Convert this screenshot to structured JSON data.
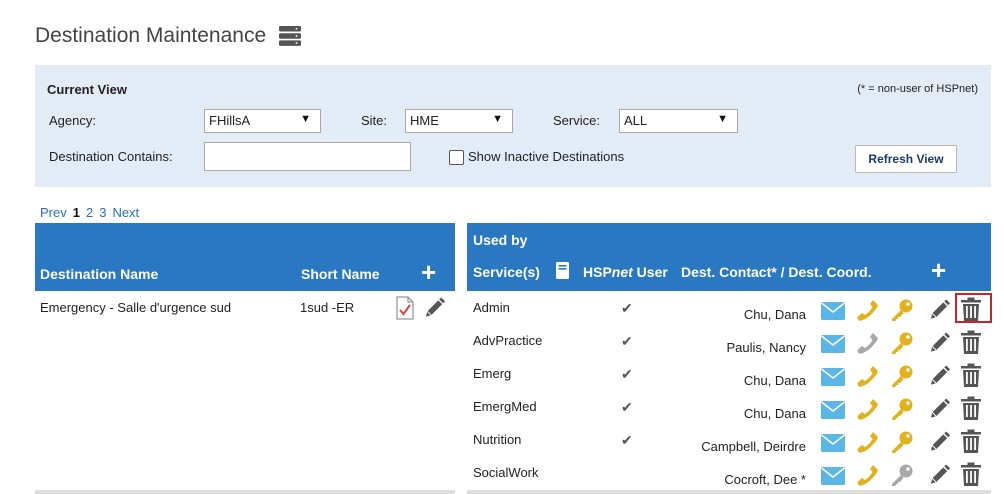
{
  "page": {
    "title": "Destination Maintenance"
  },
  "current_view": {
    "label": "Current View",
    "note": "(* = non-user of HSPnet)",
    "agency_label": "Agency:",
    "agency_value": "FHillsA",
    "site_label": "Site:",
    "site_value": "HME",
    "service_label": "Service:",
    "service_value": "ALL",
    "dest_contains_label": "Destination Contains:",
    "dest_contains_value": "",
    "show_inactive_label": "Show Inactive Destinations",
    "refresh_label": "Refresh View",
    "dropdown_arrow": "▼"
  },
  "pager": {
    "prev": "Prev",
    "pages": [
      "1",
      "2",
      "3"
    ],
    "current": "1",
    "next": "Next"
  },
  "dest_table": {
    "col_name": "Destination Name",
    "col_short": "Short Name",
    "add_icon": "+",
    "rows": [
      {
        "name": "Emergency - Salle d'urgence sud",
        "short": "1sud -ER"
      }
    ]
  },
  "used_by_table": {
    "title": "Used by",
    "col_service": "Service(s)",
    "col_hspnet_prefix": "HSP",
    "col_hspnet_em": "net",
    "col_hspnet_suffix": " User",
    "col_contact": "Dest. Contact* / Dest. Coord.",
    "add_icon": "+",
    "check": "✔",
    "rows": [
      {
        "service": "Admin",
        "user": true,
        "contact": "Chu, Dana",
        "phone_active": true,
        "key_active": true
      },
      {
        "service": "AdvPractice",
        "user": true,
        "contact": "Paulis, Nancy",
        "phone_active": false,
        "key_active": true
      },
      {
        "service": "Emerg",
        "user": true,
        "contact": "Chu, Dana",
        "phone_active": true,
        "key_active": true
      },
      {
        "service": "EmergMed",
        "user": true,
        "contact": "Chu, Dana",
        "phone_active": true,
        "key_active": true
      },
      {
        "service": "Nutrition",
        "user": true,
        "contact": "Campbell, Deirdre",
        "phone_active": true,
        "key_active": true
      },
      {
        "service": "SocialWork",
        "user": false,
        "contact": "Cocroft, Dee *",
        "phone_active": true,
        "key_active": false
      }
    ]
  },
  "colors": {
    "header_blue": "#2a78c2",
    "panel_bg": "#e3ebf7",
    "link": "#2a6ebb",
    "mail": "#5bb6e8",
    "gold": "#e3b21a",
    "inactive": "#a8a8a8",
    "icon_dark": "#555555",
    "highlight": "#d0202b"
  }
}
